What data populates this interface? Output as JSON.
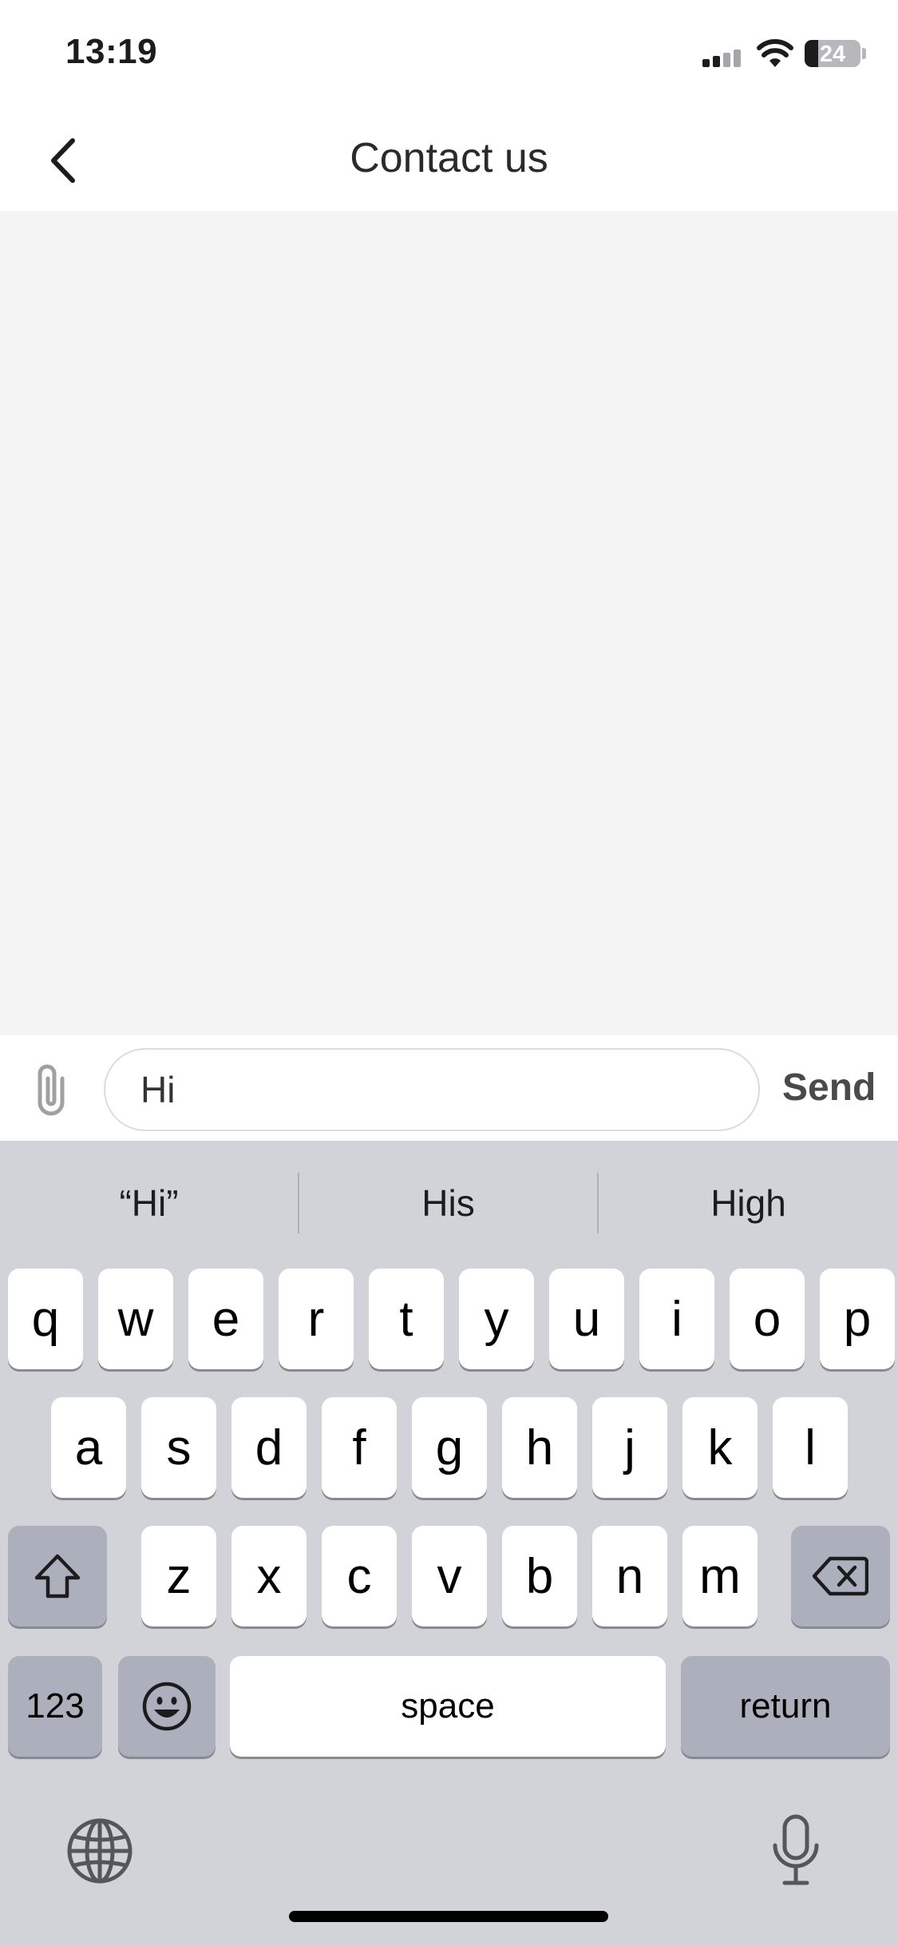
{
  "status_bar": {
    "time": "13:19",
    "battery_percent": "24"
  },
  "nav": {
    "title": "Contact us"
  },
  "composer": {
    "input_value": "Hi",
    "send_label": "Send"
  },
  "keyboard": {
    "suggestions": [
      "“Hi”",
      "His",
      "High"
    ],
    "row1": [
      "q",
      "w",
      "e",
      "r",
      "t",
      "y",
      "u",
      "i",
      "o",
      "p"
    ],
    "row2": [
      "a",
      "s",
      "d",
      "f",
      "g",
      "h",
      "j",
      "k",
      "l"
    ],
    "row3": [
      "z",
      "x",
      "c",
      "v",
      "b",
      "n",
      "m"
    ],
    "numbers_label": "123",
    "space_label": "space",
    "return_label": "return"
  },
  "colors": {
    "keyboard_bg": "#d1d3d9",
    "function_key": "#abb0bc",
    "conversation_bg": "#f4f4f4"
  }
}
